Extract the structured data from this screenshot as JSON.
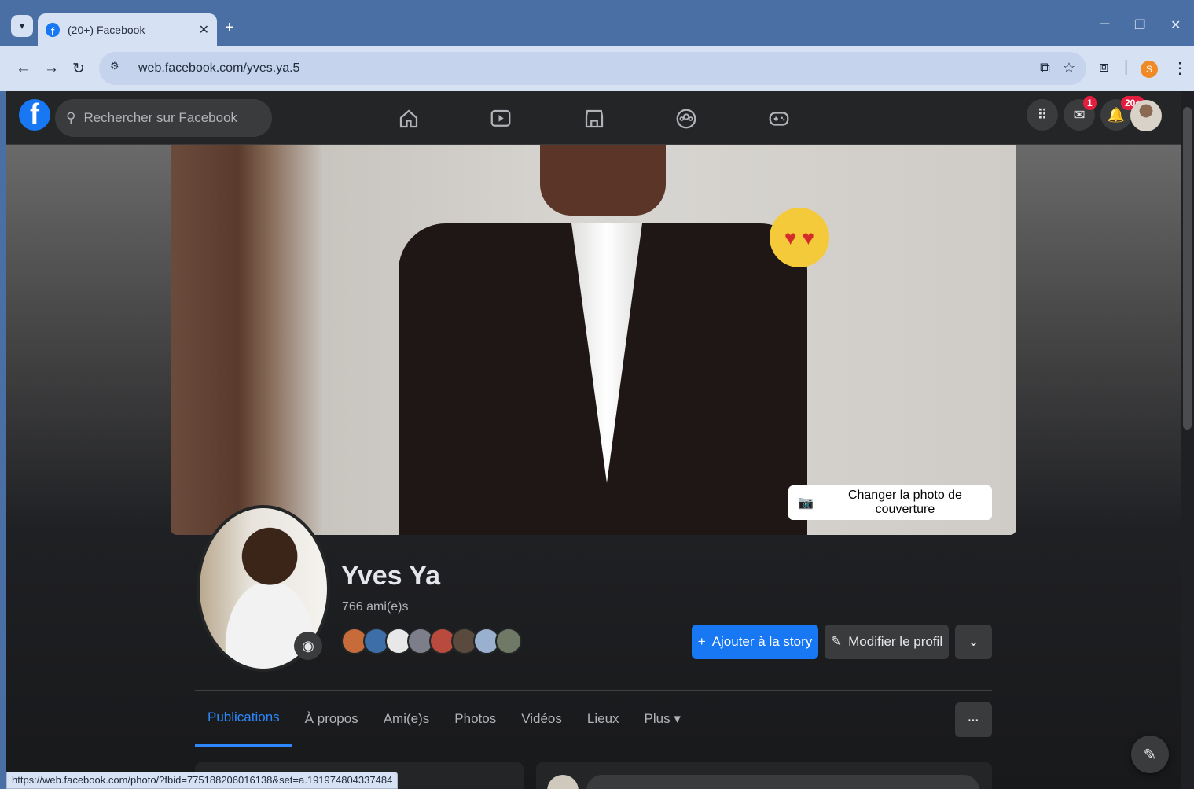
{
  "browser": {
    "tab_title": "(20+) Facebook",
    "tab_close": "✕",
    "new_tab": "+",
    "url": "web.facebook.com/yves.ya.5",
    "status_url": "https://web.facebook.com/photo/?fbid=775188206016138&set=a.191974804337484",
    "profile_initial": "S"
  },
  "fb": {
    "search_placeholder": "Rechercher sur Facebook",
    "messenger_badge": "1",
    "notifications_badge": "20+",
    "cover_button": "Changer la photo de couverture",
    "profile": {
      "name": "Yves Ya",
      "friends_count": "766 ami(e)s"
    },
    "actions": {
      "add_story": "Ajouter à la story",
      "edit_profile": "Modifier le profil"
    },
    "tabs": [
      {
        "label": "Publications",
        "active": true
      },
      {
        "label": "À propos"
      },
      {
        "label": "Ami(e)s"
      },
      {
        "label": "Photos"
      },
      {
        "label": "Vidéos"
      },
      {
        "label": "Lieux"
      },
      {
        "label": "Plus ▾"
      }
    ],
    "tab_more": "···"
  },
  "colors": {
    "accent": "#1877f2",
    "bg": "#18191b",
    "surface": "#242526"
  }
}
